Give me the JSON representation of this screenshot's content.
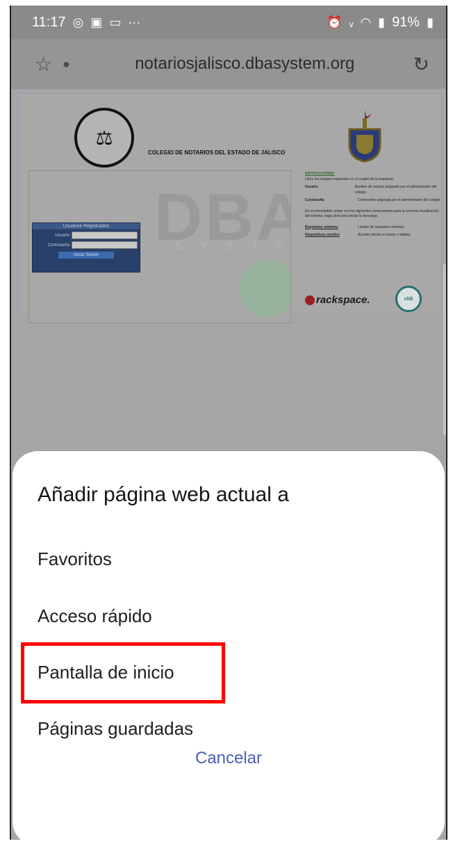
{
  "status_bar": {
    "time": "11:17",
    "notification_icons": [
      "whatsapp-icon",
      "gallery-icon",
      "laptop-icon",
      "more-icon"
    ],
    "battery": "91%"
  },
  "browser": {
    "url": "notariosjalisco.dbasystem.org"
  },
  "page": {
    "college_name": "COLEGIO DE NOTARIOS DEL ESTADO DE JALISCO",
    "login_header": "Usuarios Registrados",
    "usuario_label": "Usuario",
    "password_label": "Contraseña",
    "login_button": "Iniciar Sesión",
    "instructions_title": "INSTRUCCIONES:",
    "instructions_text": "Llene los campos requeridos en el cuadro de la izquierda.",
    "usuario_desc": "Nombre de usuario asignado por el administrador del colegio.",
    "password_desc": "Contraseña asignada por el administrador del colegio.",
    "recommendation": "Es recomendable contar con los siguientes componentes para la correcta visualización del sistema, haga click para iniciar la descarga:",
    "req_link": "Requisitos mínimos",
    "req_desc": "Listado de requisitos mínimos.",
    "mobile_link": "Dispositivos móviles",
    "mobile_desc": "Acceder desde el celular o tableta.",
    "dba_text": "DBA",
    "system_text": "SYSTEM",
    "rackspace": "rackspace.",
    "cfdi": "cfdi"
  },
  "sheet": {
    "title": "Añadir página web actual a",
    "items": [
      "Favoritos",
      "Acceso rápido",
      "Pantalla de inicio",
      "Páginas guardadas"
    ],
    "cancel": "Cancelar",
    "highlighted_item": "Pantalla de inicio",
    "highlight_color": "#ff0000"
  }
}
